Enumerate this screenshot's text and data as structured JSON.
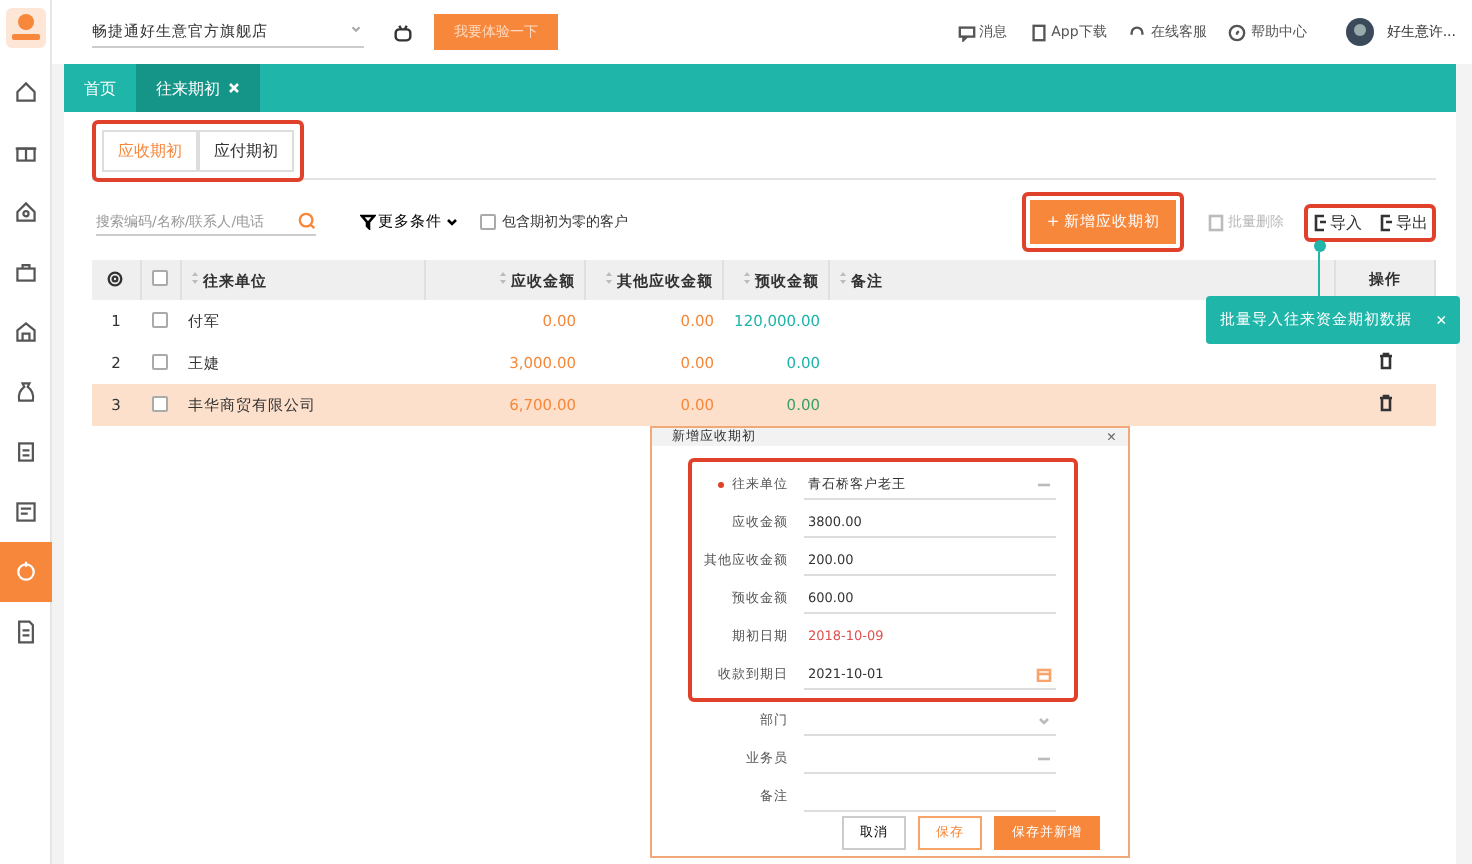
{
  "topbar": {
    "store": "畅捷通好生意官方旗舰店",
    "trial_button": "我要体验一下",
    "links": [
      {
        "kind": "message",
        "label": "消息"
      },
      {
        "kind": "app",
        "label": "App下载"
      },
      {
        "kind": "service",
        "label": "在线客服"
      },
      {
        "kind": "help",
        "label": "帮助中心"
      }
    ],
    "user": "好生意许..."
  },
  "sidebar": {
    "items": [
      {
        "selected": false
      },
      {
        "selected": false
      },
      {
        "selected": false
      },
      {
        "selected": false
      },
      {
        "selected": false
      },
      {
        "selected": false
      },
      {
        "selected": false
      },
      {
        "selected": false
      },
      {
        "selected": true
      },
      {
        "selected": false
      }
    ]
  },
  "page_tabs": [
    {
      "label": "首页",
      "selected": false,
      "closable": false
    },
    {
      "label": "往来期初",
      "selected": true,
      "closable": true
    }
  ],
  "sub_tabs": {
    "highlighted": true,
    "items": [
      {
        "label": "应收期初",
        "selected": true
      },
      {
        "label": "应付期初",
        "selected": false
      }
    ]
  },
  "search": {
    "placeholder": "搜索编码/名称/联系人/电话"
  },
  "filter": "更多条件",
  "include_zero": {
    "label": "包含期初为零的客户",
    "checked": false
  },
  "actions": {
    "add": {
      "label": "+ 新增应收期初",
      "highlighted": true
    },
    "batch_delete": {
      "label": "批量删除",
      "disabled": true
    },
    "io_highlighted": true,
    "import": "导入",
    "export": "导出"
  },
  "table": {
    "all_checked": false,
    "columns": [
      "往来单位",
      "应收金额",
      "其他应收金额",
      "预收金额",
      "备注",
      "操作"
    ],
    "rows": [
      {
        "index": "1",
        "checked": false,
        "selected": false,
        "unit": "付军",
        "receivable": "0.00",
        "other": "0.00",
        "advance": "120,000.00"
      },
      {
        "index": "2",
        "checked": false,
        "selected": false,
        "unit": "王婕",
        "receivable": "3,000.00",
        "other": "0.00",
        "advance": "0.00"
      },
      {
        "index": "3",
        "checked": false,
        "selected": true,
        "unit": "丰华商贸有限公司",
        "receivable": "6,700.00",
        "other": "0.00",
        "advance": "0.00"
      }
    ]
  },
  "tooltip": {
    "text": "批量导入往来资金期初数据",
    "close": "×"
  },
  "dialog": {
    "title": "新增应收期初",
    "close": "×",
    "highlight_frame": true,
    "framed_fields": [
      {
        "kind": "ref",
        "label": "往来单位",
        "required": true,
        "value": "青石桥客户老王"
      },
      {
        "kind": "text",
        "label": "应收金额",
        "required": false,
        "value": "3800.00"
      },
      {
        "kind": "text",
        "label": "其他应收金额",
        "required": false,
        "value": "200.00"
      },
      {
        "kind": "text",
        "label": "预收金额",
        "required": false,
        "value": "600.00"
      },
      {
        "kind": "readonly",
        "label": "期初日期",
        "required": false,
        "value": "2018-10-09"
      },
      {
        "kind": "date",
        "label": "收款到期日",
        "required": false,
        "value": "2021-10-01"
      }
    ],
    "fields": [
      {
        "kind": "select",
        "label": "部门",
        "required": false
      },
      {
        "kind": "ref",
        "label": "业务员",
        "required": false
      },
      {
        "kind": "text",
        "label": "备注",
        "required": false
      }
    ],
    "buttons": [
      {
        "kind": "plain",
        "label": "取消"
      },
      {
        "kind": "outline",
        "label": "保存"
      },
      {
        "kind": "primary",
        "label": "保存并新增"
      }
    ]
  }
}
